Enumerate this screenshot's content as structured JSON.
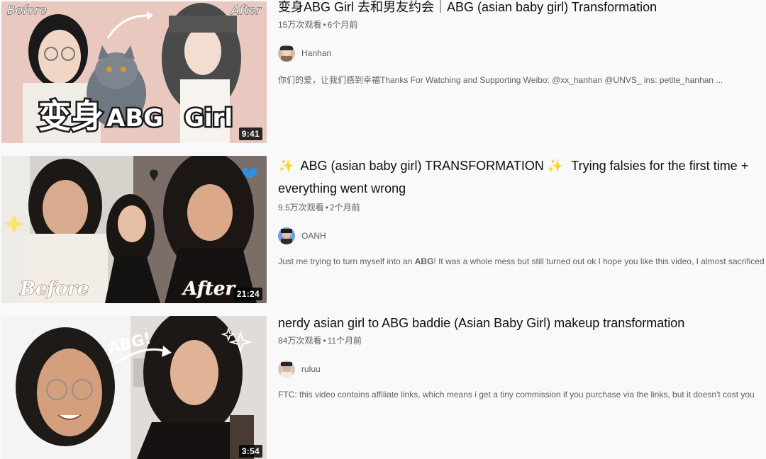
{
  "results": [
    {
      "title": "变身ABG Girl 去和男友约会｜ABG (asian baby girl) Transformation",
      "views": "15万次观看",
      "age": "6个月前",
      "channel": "Hanhan",
      "description": "你们的爱，让我们感到幸福Thanks For Watching and Supporting Weibo: @xx_hanhan @UNVS_ ins: petite_hanhan ...",
      "duration": "9:41",
      "thumb_text": {
        "before": "Before",
        "after": "After",
        "caption_cn": "变身",
        "caption_abg": "ABG",
        "caption_girl": "Girl"
      },
      "thumb_bg": "#e9c9c0"
    },
    {
      "title_prefix": "✨",
      "title_main": "ABG (asian baby girl) TRANSFORMATION",
      "title_mid": "✨",
      "title_rest": "Trying falsies for the first time + everything went wrong",
      "views": "9.5万次观看",
      "age": "2个月前",
      "channel": "OANH",
      "description_before": "Just me trying to turn myself into an ",
      "description_bold": "ABG",
      "description_after": "! It was a whole mess but still turned out ok I hope you like this video, I almost sacrificed",
      "duration": "21:24",
      "thumb_text": {
        "before": "Before",
        "after": "After"
      }
    },
    {
      "title": "nerdy asian girl to ABG baddie (Asian Baby Girl) makeup transformation",
      "views": "84万次观看",
      "age": "11个月前",
      "channel": "ruluu",
      "description": "FTC: this video contains affiliate links, which means i get a tiny commission if you purchase via the links, but it doesn't cost you",
      "duration": "3:54",
      "thumb_text": {
        "abg": "ABG!"
      }
    }
  ],
  "separator": "•",
  "colors": {
    "page_bg": "#f9f9f9",
    "title": "#0f0f0f",
    "meta": "#606060",
    "duration_bg": "#000000"
  }
}
